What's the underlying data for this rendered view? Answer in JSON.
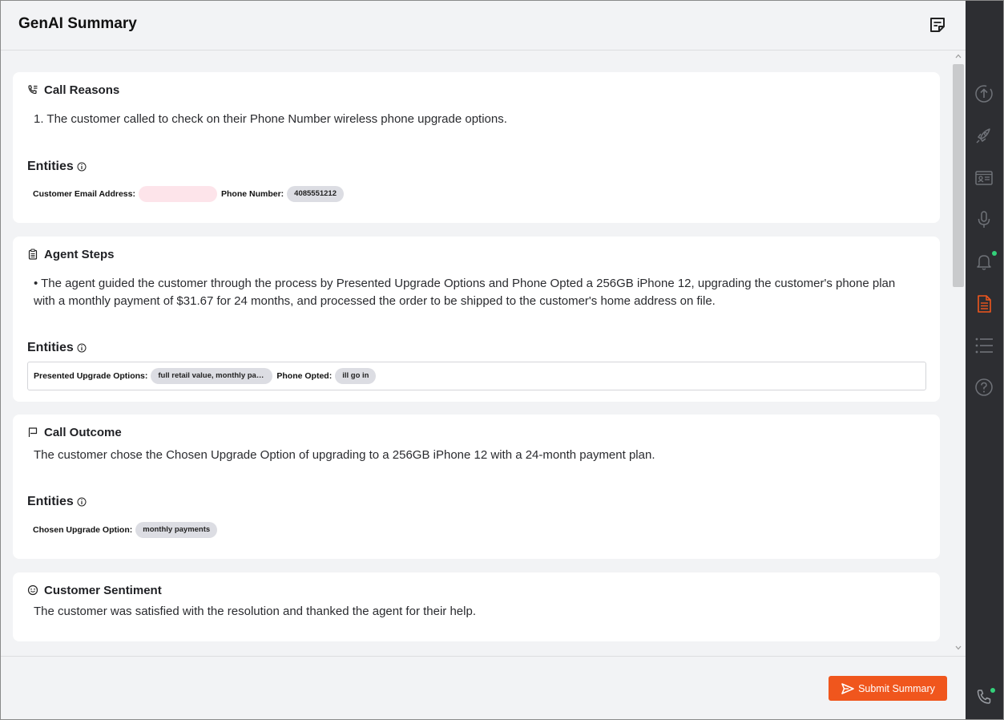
{
  "header": {
    "title": "GenAI Summary",
    "notes_icon": "sticky-note-icon"
  },
  "sections": {
    "call_reasons": {
      "title": "Call Reasons",
      "icon": "phone-list-icon",
      "text": "1. The customer called to check on their Phone Number wireless phone upgrade options.",
      "entities_label": "Entities",
      "entities": [
        {
          "key": "Customer Email Address:",
          "value": ""
        },
        {
          "key": "Phone Number:",
          "value": "4085551212"
        }
      ]
    },
    "agent_steps": {
      "title": "Agent Steps",
      "icon": "clipboard-icon",
      "text": "• The agent guided the customer through the process by Presented Upgrade Options and Phone Opted a 256GB iPhone 12, upgrading the customer's phone plan with a monthly payment of $31.67 for 24 months, and processed the order to be shipped to the customer's home address on file.",
      "entities_label": "Entities",
      "entities": [
        {
          "key": "Presented Upgrade Options:",
          "value": "full retail value, monthly pay..."
        },
        {
          "key": "Phone Opted:",
          "value": "ill go in"
        }
      ]
    },
    "call_outcome": {
      "title": "Call Outcome",
      "icon": "flag-icon",
      "text": "The customer chose the Chosen Upgrade Option of upgrading to a 256GB iPhone 12 with a 24-month payment plan.",
      "entities_label": "Entities",
      "entities": [
        {
          "key": "Chosen Upgrade Option:",
          "value": "monthly payments"
        }
      ]
    },
    "customer_sentiment": {
      "title": "Customer Sentiment",
      "icon": "smiley-icon",
      "text": "The customer was satisfied with the resolution and thanked the agent for their help."
    }
  },
  "footer": {
    "submit_label": "Submit Summary"
  },
  "rail": {
    "items": [
      "upload-circle-icon",
      "rocket-icon",
      "id-card-icon",
      "microphone-icon",
      "bell-icon",
      "document-icon",
      "list-icon",
      "help-icon",
      "phone-icon"
    ],
    "active": "document-icon",
    "accent_color": "#f0561d",
    "status_color": "#33d17a"
  },
  "colors": {
    "accent": "#f0561d",
    "rail_bg": "#2d2e32",
    "chip_bg": "#dcdde3"
  }
}
